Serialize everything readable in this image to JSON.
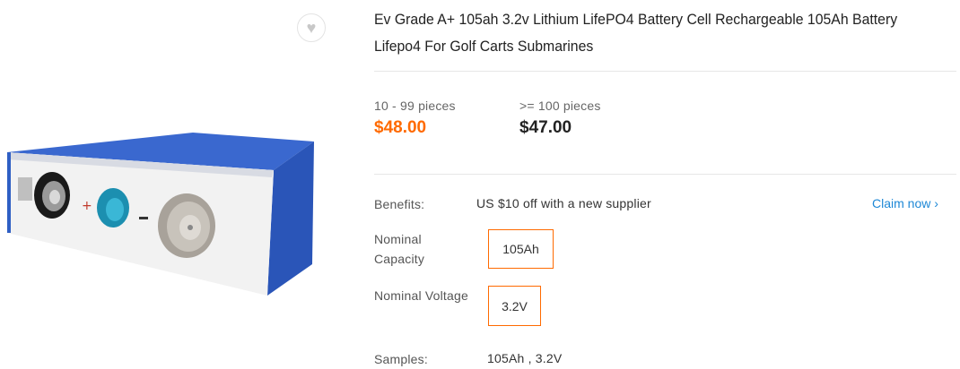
{
  "product": {
    "title": "Ev Grade A+ 105ah 3.2v Lithium LifePO4 Battery Cell Rechargeable 105Ah Battery Lifepo4 For Golf Carts Submarines",
    "image_icon": "battery-cell-image"
  },
  "favorite": {
    "icon": "heart-icon",
    "glyph": "♥"
  },
  "pricing": {
    "tiers": [
      {
        "quantity": "10 - 99 pieces",
        "price": "$48.00"
      },
      {
        "quantity": ">= 100 pieces",
        "price": "$47.00"
      }
    ]
  },
  "benefits": {
    "label": "Benefits:",
    "text": "US $10 off with a new supplier",
    "claim": "Claim now ›"
  },
  "attributes": {
    "capacity": {
      "label_line1": "Nominal",
      "label_line2": "Capacity",
      "value": "105Ah"
    },
    "voltage": {
      "label": "Nominal Voltage",
      "value": "3.2V"
    }
  },
  "samples": {
    "label": "Samples:",
    "value": "105Ah , 3.2V"
  },
  "colors": {
    "accent": "#ff6a00",
    "link": "#1e88d6",
    "battery_blue": "#2f5fc4"
  }
}
